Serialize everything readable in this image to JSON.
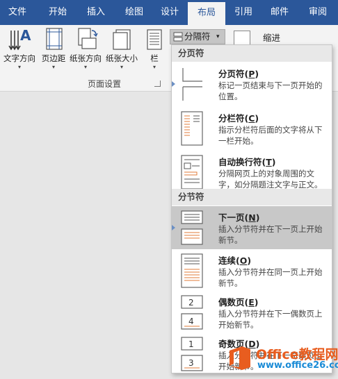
{
  "tabs": [
    {
      "label": "文件"
    },
    {
      "label": "开始"
    },
    {
      "label": "插入"
    },
    {
      "label": "绘图"
    },
    {
      "label": "设计"
    },
    {
      "label": "布局"
    },
    {
      "label": "引用"
    },
    {
      "label": "邮件"
    },
    {
      "label": "审阅"
    }
  ],
  "active_tab": "布局",
  "ribbon": {
    "buttons": [
      {
        "label": "文字方向",
        "icon": "text-direction-icon"
      },
      {
        "label": "页边距",
        "icon": "margins-icon"
      },
      {
        "label": "纸张方向",
        "icon": "orientation-icon"
      },
      {
        "label": "纸张大小",
        "icon": "size-icon"
      },
      {
        "label": "栏",
        "icon": "columns-icon"
      }
    ],
    "breaks_label": "分隔符",
    "indent_label": "缩进",
    "group_label": "页面设置"
  },
  "menu": {
    "section1": "分页符",
    "section2": "分节符",
    "items": [
      {
        "title": "分页符",
        "key": "P",
        "desc": "标记一页结束与下一页开始的位置。",
        "icon": "page-break-icon"
      },
      {
        "title": "分栏符",
        "key": "C",
        "desc": "指示分栏符后面的文字将从下一栏开始。",
        "icon": "column-break-icon"
      },
      {
        "title": "自动换行符",
        "key": "T",
        "desc": "分隔网页上的对象周围的文字，如分隔题注文字与正文。",
        "icon": "text-wrapping-break-icon"
      },
      {
        "title": "下一页",
        "key": "N",
        "desc": "插入分节符并在下一页上开始新节。",
        "icon": "next-page-section-icon"
      },
      {
        "title": "连续",
        "key": "O",
        "desc": "插入分节符并在同一页上开始新节。",
        "icon": "continuous-section-icon"
      },
      {
        "title": "偶数页",
        "key": "E",
        "desc": "插入分节符并在下一偶数页上开始新节。",
        "icon": "even-page-section-icon"
      },
      {
        "title": "奇数页",
        "key": "D",
        "desc": "插入分节符并在下一奇数页上开始新节。",
        "icon": "odd-page-section-icon"
      }
    ]
  },
  "watermark": {
    "line1": "Office教程网",
    "line2": "www.office26.com"
  },
  "colors": {
    "ribbon_blue": "#2b579a",
    "selected_item": "#c8c8c8",
    "watermark_orange": "#e85d1f",
    "watermark_blue": "#1a8bd6"
  }
}
